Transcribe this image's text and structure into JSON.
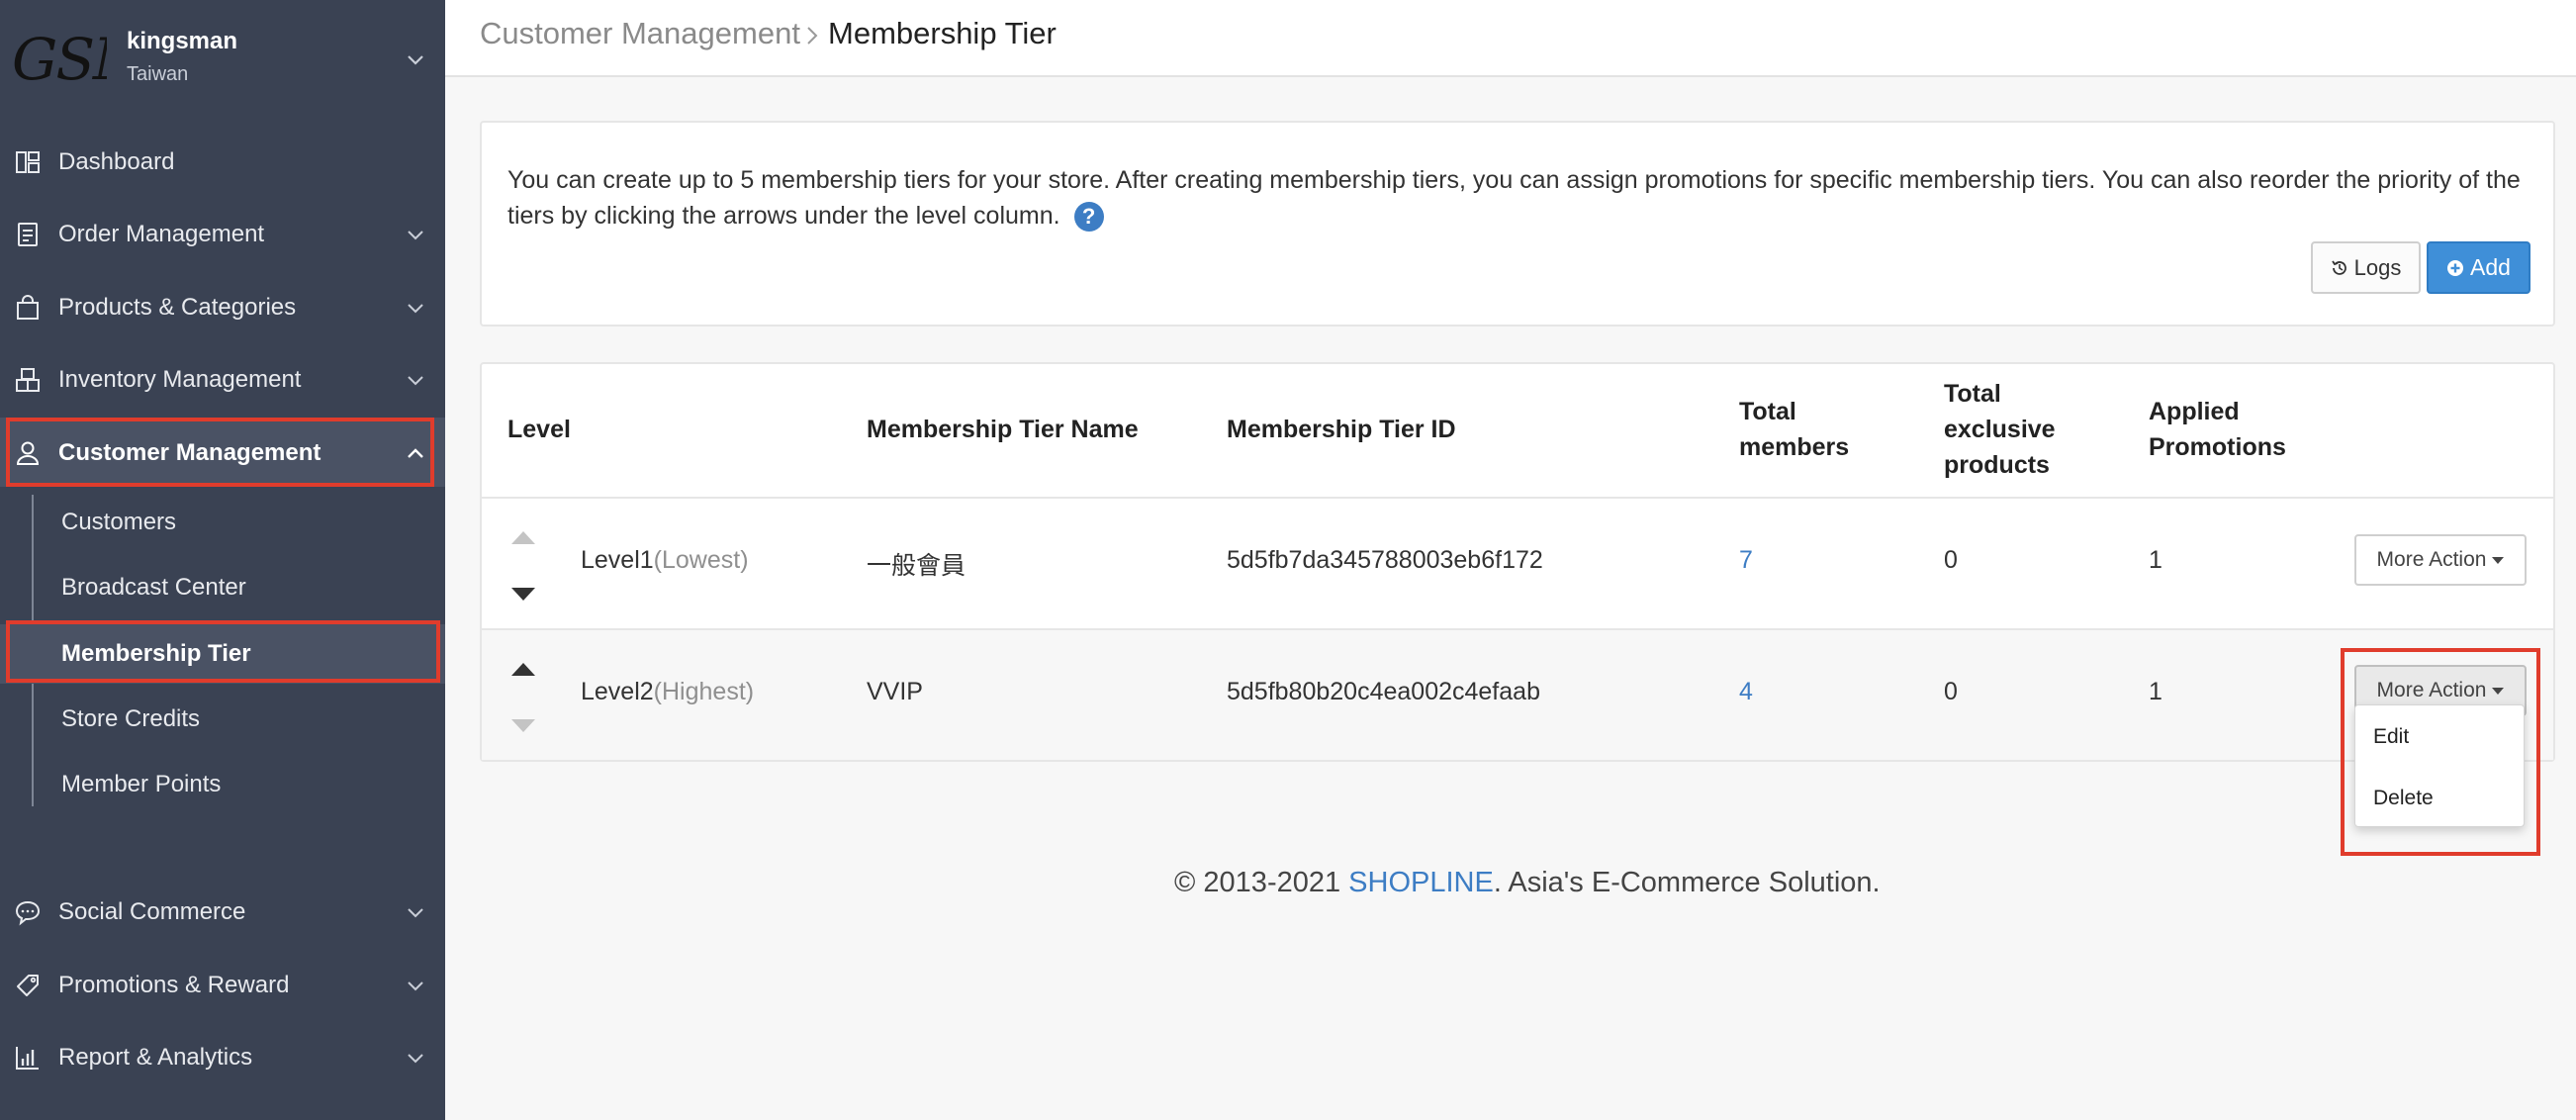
{
  "store": {
    "logo_text": "GSN",
    "name": "kingsman",
    "region": "Taiwan"
  },
  "sidebar": {
    "items": [
      {
        "label": "Dashboard",
        "icon": "dashboard-icon",
        "has_chevron": false
      },
      {
        "label": "Order Management",
        "icon": "clipboard-icon",
        "has_chevron": true
      },
      {
        "label": "Products & Categories",
        "icon": "shopping-bag-icon",
        "has_chevron": true
      },
      {
        "label": "Inventory Management",
        "icon": "boxes-icon",
        "has_chevron": true
      },
      {
        "label": "Customer Management",
        "icon": "user-icon",
        "has_chevron": true,
        "expanded": true,
        "active": true
      },
      {
        "label": "Social Commerce",
        "icon": "chat-bubble-icon",
        "has_chevron": true
      },
      {
        "label": "Promotions & Reward",
        "icon": "tag-icon",
        "has_chevron": true
      },
      {
        "label": "Report & Analytics",
        "icon": "bar-chart-icon",
        "has_chevron": true
      }
    ],
    "customer_submenu": [
      {
        "label": "Customers"
      },
      {
        "label": "Broadcast Center"
      },
      {
        "label": "Membership Tier",
        "active": true
      },
      {
        "label": "Store Credits"
      },
      {
        "label": "Member Points"
      }
    ]
  },
  "breadcrumb": {
    "parent": "Customer Management",
    "current": "Membership Tier"
  },
  "info": {
    "text": "You can create up to 5 membership tiers for your store. After creating membership tiers, you can assign promotions for specific membership tiers. You can also reorder the priority of the tiers by clicking the arrows under the level column.",
    "help_symbol": "?",
    "logs_label": "Logs",
    "add_label": "Add"
  },
  "table": {
    "headers": {
      "level": "Level",
      "name": "Membership Tier Name",
      "id": "Membership Tier ID",
      "total_members": [
        "Total",
        "members"
      ],
      "exclusive": [
        "Total",
        "exclusive",
        "products"
      ],
      "promotions": [
        "Applied",
        "Promotions"
      ]
    },
    "rows": [
      {
        "level": "Level1",
        "level_note": "(Lowest)",
        "name": "一般會員",
        "tier_id": "5d5fb7da345788003eb6f172",
        "total_members": "7",
        "exclusive_products": "0",
        "applied_promotions": "1",
        "action_label": "More Action",
        "up_enabled": false,
        "down_enabled": true
      },
      {
        "level": "Level2",
        "level_note": "(Highest)",
        "name": "VVIP",
        "tier_id": "5d5fb80b20c4ea002c4efaab",
        "total_members": "4",
        "exclusive_products": "0",
        "applied_promotions": "1",
        "action_label": "More Action",
        "up_enabled": true,
        "down_enabled": false
      }
    ]
  },
  "dropdown": {
    "items": [
      "Edit",
      "Delete"
    ]
  },
  "footer": {
    "prefix": "© 2013-2021 ",
    "brand": "SHOPLINE",
    "suffix": ". Asia's E-Commerce Solution."
  },
  "colors": {
    "sidebar_bg": "#3a4253",
    "accent_blue": "#3f8fd8",
    "link_blue": "#3d7dc4",
    "highlight_red": "#e03c2c"
  }
}
